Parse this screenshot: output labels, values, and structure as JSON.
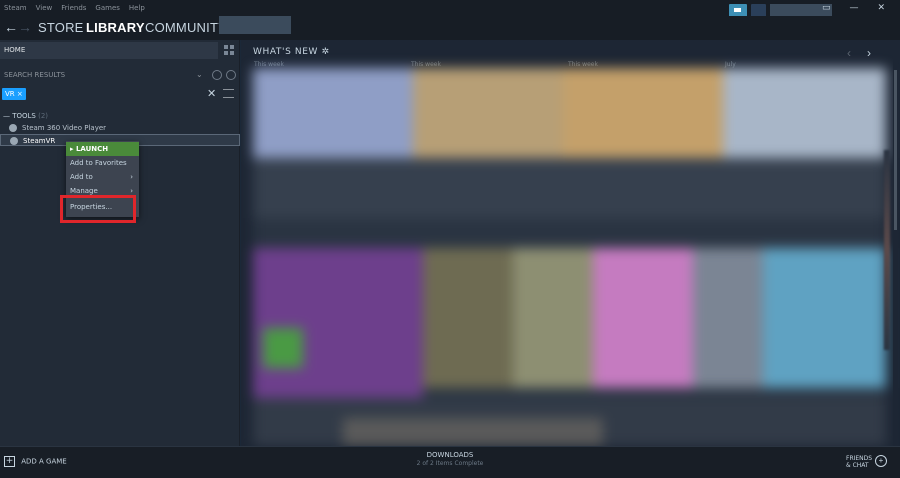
{
  "menubar": {
    "items": [
      "Steam",
      "View",
      "Friends",
      "Games",
      "Help"
    ],
    "window_controls": [
      "▭",
      "—",
      "✕"
    ]
  },
  "nav": {
    "back": "←",
    "forward": "→",
    "tabs": [
      {
        "label": "STORE"
      },
      {
        "label": "LIBRARY"
      },
      {
        "label": "COMMUNITY"
      }
    ]
  },
  "sidebar": {
    "home_label": "HOME",
    "search_results_label": "SEARCH RESULTS",
    "search_chevron": "⌄",
    "filter_tag": "VR ×",
    "filter_close": "✕",
    "tools_label": "— TOOLS",
    "tools_count": "(2)",
    "games": [
      {
        "label": "Steam 360 Video Player"
      },
      {
        "label": "SteamVR"
      }
    ]
  },
  "context_menu": {
    "items": [
      {
        "label": "▸ LAUNCH"
      },
      {
        "label": "Add to Favorites"
      },
      {
        "label": "Add to",
        "arrow": "›"
      },
      {
        "label": "Manage",
        "arrow": "›"
      },
      {
        "label": "Properties..."
      }
    ]
  },
  "main": {
    "whats_new_title": "WHAT'S NEW ✲",
    "prev_arrow": "‹",
    "next_arrow": "›",
    "columns": [
      "This week",
      "This week",
      "This week",
      "July"
    ]
  },
  "bottombar": {
    "add_game": "ADD A GAME",
    "add_game_icon": "+",
    "downloads_title": "DOWNLOADS",
    "downloads_status": "2 of 2 Items Complete",
    "friends_line1": "FRIENDS",
    "friends_line2": "& CHAT",
    "friends_icon": "+"
  },
  "colors": {
    "background": "#1b2838",
    "accent": "#1a9fff",
    "launch_green": "#4a8a3a",
    "highlight_red": "#e0262b"
  }
}
